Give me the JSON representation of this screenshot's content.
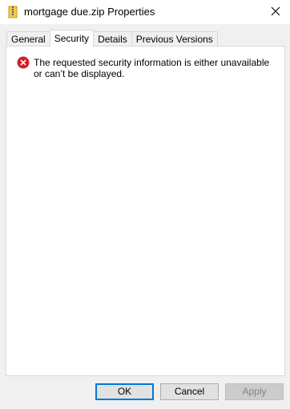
{
  "window": {
    "title": "mortgage due.zip Properties",
    "icon": "zip-folder-icon",
    "close_glyph": "✕"
  },
  "tabs": [
    {
      "label": "General",
      "active": false
    },
    {
      "label": "Security",
      "active": true
    },
    {
      "label": "Details",
      "active": false
    },
    {
      "label": "Previous Versions",
      "active": false
    }
  ],
  "message": {
    "icon": "error-icon",
    "text": "The requested security information is either unavailable or can’t be displayed."
  },
  "buttons": {
    "ok_label": "OK",
    "cancel_label": "Cancel",
    "apply_label": "Apply"
  },
  "colors": {
    "error_red": "#d11f2b",
    "accent_blue": "#0078d7"
  }
}
